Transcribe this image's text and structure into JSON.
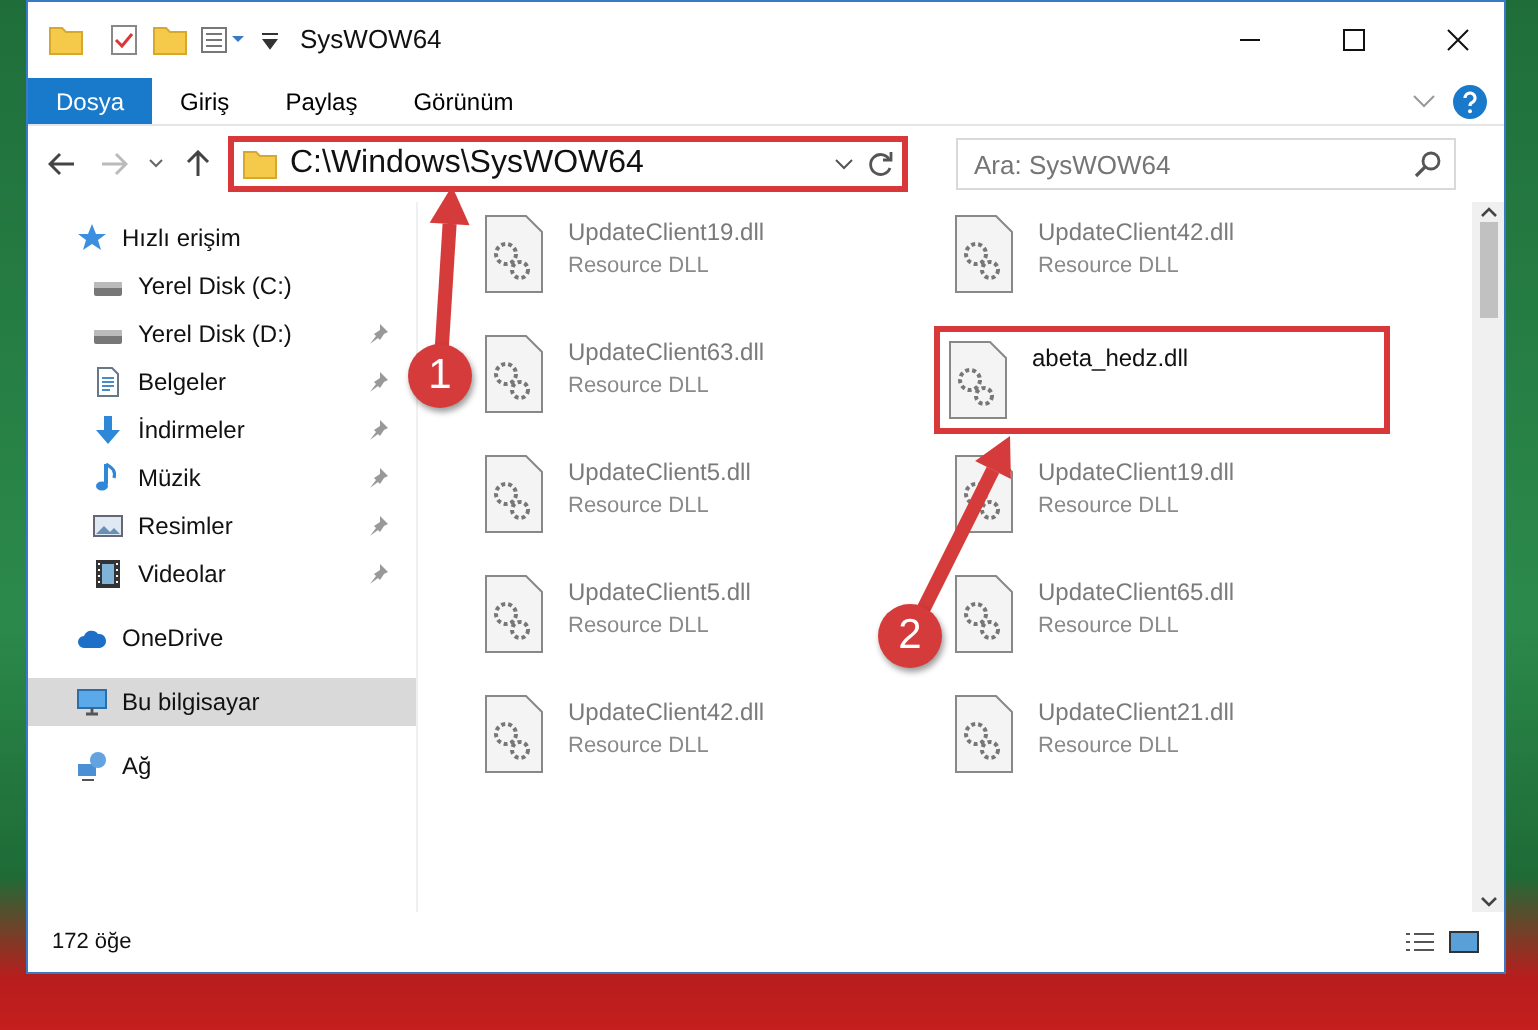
{
  "window": {
    "title": "SysWOW64"
  },
  "ribbon_tabs": [
    {
      "label": "Dosya",
      "kind": "file"
    },
    {
      "label": "Giriş",
      "kind": "tab"
    },
    {
      "label": "Paylaş",
      "kind": "tab"
    },
    {
      "label": "Görünüm",
      "kind": "tab"
    }
  ],
  "address_bar": {
    "path": "C:\\Windows\\SysWOW64",
    "highlighted": true
  },
  "search": {
    "placeholder": "Ara: SysWOW64"
  },
  "sidebar": {
    "items": [
      {
        "label": "Hızlı erişim",
        "selected": false,
        "children": [
          {
            "label": "Yerel Disk (C:)",
            "pinned": false,
            "selected": false
          },
          {
            "label": "Yerel Disk (D:)",
            "pinned": true,
            "selected": false
          },
          {
            "label": "Belgeler",
            "pinned": true,
            "selected": false
          },
          {
            "label": "İndirmeler",
            "pinned": true,
            "selected": false
          },
          {
            "label": "Müzik",
            "pinned": true,
            "selected": false
          },
          {
            "label": "Resimler",
            "pinned": true,
            "selected": false
          },
          {
            "label": "Videolar",
            "pinned": true,
            "selected": false
          }
        ]
      },
      {
        "label": "OneDrive",
        "selected": false
      },
      {
        "label": "Bu bilgisayar",
        "selected": true
      },
      {
        "label": "Ağ",
        "selected": false
      }
    ]
  },
  "files": [
    {
      "name": "UpdateClient19.dll",
      "type": "Resource DLL",
      "highlighted": false
    },
    {
      "name": "UpdateClient42.dll",
      "type": "Resource DLL",
      "highlighted": false
    },
    {
      "name": "UpdateClient63.dll",
      "type": "Resource DLL",
      "highlighted": false
    },
    {
      "name": "abeta_hedz.dll",
      "highlighted": true
    },
    {
      "name": "UpdateClient5.dll",
      "type": "Resource DLL",
      "highlighted": false
    },
    {
      "name": "UpdateClient19.dll",
      "type": "Resource DLL",
      "highlighted": false
    },
    {
      "name": "UpdateClient5.dll",
      "type": "Resource DLL",
      "highlighted": false
    },
    {
      "name": "UpdateClient65.dll",
      "type": "Resource DLL",
      "highlighted": false
    },
    {
      "name": "UpdateClient42.dll",
      "type": "Resource DLL",
      "highlighted": false
    },
    {
      "name": "UpdateClient21.dll",
      "type": "Resource DLL",
      "highlighted": false
    }
  ],
  "status_bar": {
    "item_count": "172 öğe"
  },
  "callouts": [
    {
      "label": "1"
    },
    {
      "label": "2"
    }
  ]
}
